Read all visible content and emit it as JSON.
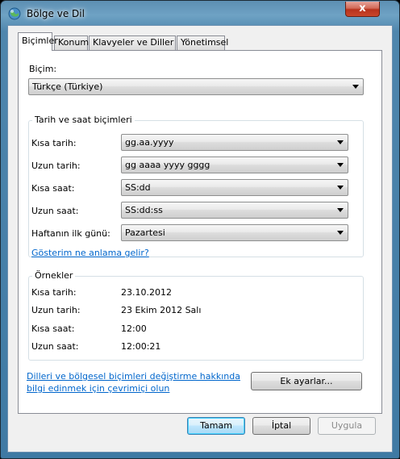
{
  "window": {
    "title": "Bölge ve Dil",
    "close_glyph": "x"
  },
  "tabs": [
    {
      "label": "Biçimler",
      "active": true
    },
    {
      "label": "Konum",
      "active": false
    },
    {
      "label": "Klavyeler ve Diller",
      "active": false
    },
    {
      "label": "Yönetimsel",
      "active": false
    }
  ],
  "format": {
    "label": "Biçim:",
    "value": "Türkçe (Türkiye)"
  },
  "datetime": {
    "title": "Tarih ve saat biçimleri",
    "rows": [
      {
        "label": "Kısa tarih:",
        "value": "gg.aa.yyyy"
      },
      {
        "label": "Uzun tarih:",
        "value": "gg aaaa yyyy gggg"
      },
      {
        "label": "Kısa saat:",
        "value": "SS:dd"
      },
      {
        "label": "Uzun saat:",
        "value": "SS:dd:ss"
      },
      {
        "label": "Haftanın ilk günü:",
        "value": "Pazartesi"
      }
    ],
    "help_link": "Gösterim ne anlama gelir?"
  },
  "examples": {
    "title": "Örnekler",
    "rows": [
      {
        "label": "Kısa tarih:",
        "value": "23.10.2012"
      },
      {
        "label": "Uzun tarih:",
        "value": "23 Ekim 2012 Salı"
      },
      {
        "label": "Kısa saat:",
        "value": "12:00"
      },
      {
        "label": "Uzun saat:",
        "value": "12:00:21"
      }
    ]
  },
  "online_link": {
    "line1": "Dilleri ve bölgesel biçimleri değiştirme hakkında",
    "line2": "bilgi edinmek için çevrimiçi olun"
  },
  "buttons": {
    "additional": "Ek ayarlar...",
    "ok": "Tamam",
    "cancel": "İptal",
    "apply": "Uygula"
  },
  "icons": {
    "app": "globe-icon",
    "close": "close-icon",
    "dropdown": "chevron-down-icon"
  }
}
